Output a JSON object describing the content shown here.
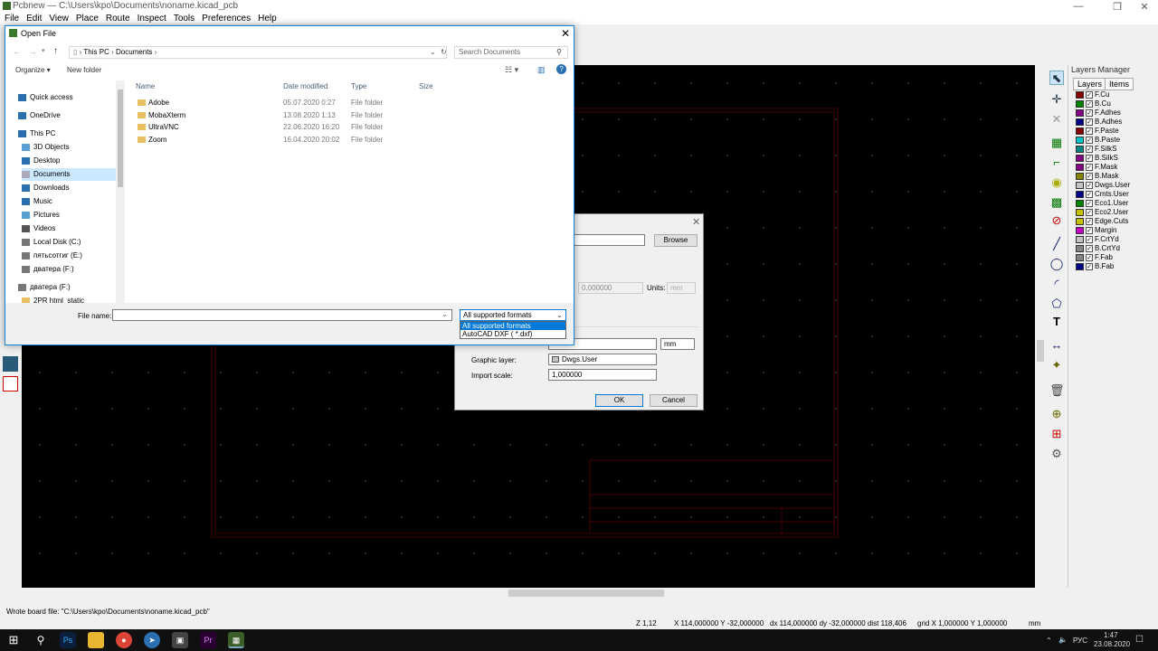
{
  "app": {
    "title": "Pcbnew — C:\\Users\\kpo\\Documents\\noname.kicad_pcb",
    "menu": [
      "File",
      "Edit",
      "View",
      "Place",
      "Route",
      "Inspect",
      "Tools",
      "Preferences",
      "Help"
    ]
  },
  "layers_manager": {
    "title": "Layers Manager",
    "tabs": [
      "Layers",
      "Items"
    ],
    "layers": [
      {
        "name": "F.Cu",
        "color": "#840000"
      },
      {
        "name": "B.Cu",
        "color": "#008400"
      },
      {
        "name": "F.Adhes",
        "color": "#840084"
      },
      {
        "name": "B.Adhes",
        "color": "#000084"
      },
      {
        "name": "F.Paste",
        "color": "#840000"
      },
      {
        "name": "B.Paste",
        "color": "#00c2c2"
      },
      {
        "name": "F.SilkS",
        "color": "#008484"
      },
      {
        "name": "B.SilkS",
        "color": "#840084"
      },
      {
        "name": "F.Mask",
        "color": "#840084"
      },
      {
        "name": "B.Mask",
        "color": "#848400"
      },
      {
        "name": "Dwgs.User",
        "color": "#c2c2c2"
      },
      {
        "name": "Cmts.User",
        "color": "#000084"
      },
      {
        "name": "Eco1.User",
        "color": "#008400"
      },
      {
        "name": "Eco2.User",
        "color": "#c2c200"
      },
      {
        "name": "Edge.Cuts",
        "color": "#c2c200"
      },
      {
        "name": "Margin",
        "color": "#c200c2"
      },
      {
        "name": "F.CrtYd",
        "color": "#c2c2c2"
      },
      {
        "name": "B.CrtYd",
        "color": "#848484"
      },
      {
        "name": "F.Fab",
        "color": "#848484"
      },
      {
        "name": "B.Fab",
        "color": "#000084"
      }
    ]
  },
  "import_dialog": {
    "browse": "Browse",
    "coord_value": "0,000000",
    "units_label": "Units:",
    "units_value": "mm",
    "line_width_units": "mm",
    "graphic_layer_label": "Graphic layer:",
    "graphic_layer_value": "Dwgs.User",
    "import_scale_label": "Import scale:",
    "import_scale_value": "1,000000",
    "ok": "OK",
    "cancel": "Cancel"
  },
  "open_file": {
    "title": "Open File",
    "breadcrumb": [
      "This PC",
      "Documents"
    ],
    "search_placeholder": "Search Documents",
    "organize": "Organize ▾",
    "new_folder": "New folder",
    "nav": [
      {
        "label": "Quick access",
        "icon": "star-icon",
        "indent": 0
      },
      {
        "label": "OneDrive",
        "icon": "cloud-icon",
        "indent": 0
      },
      {
        "label": "This PC",
        "icon": "computer-icon",
        "indent": 0
      },
      {
        "label": "3D Objects",
        "icon": "cube-icon",
        "indent": 1
      },
      {
        "label": "Desktop",
        "icon": "desktop-icon",
        "indent": 1
      },
      {
        "label": "Documents",
        "icon": "document-icon",
        "indent": 1,
        "selected": true
      },
      {
        "label": "Downloads",
        "icon": "download-icon",
        "indent": 1
      },
      {
        "label": "Music",
        "icon": "music-icon",
        "indent": 1
      },
      {
        "label": "Pictures",
        "icon": "picture-icon",
        "indent": 1
      },
      {
        "label": "Videos",
        "icon": "video-icon",
        "indent": 1
      },
      {
        "label": "Local Disk (C:)",
        "icon": "disk-icon",
        "indent": 1
      },
      {
        "label": "пятьсотгиг (E:)",
        "icon": "drive-icon",
        "indent": 1
      },
      {
        "label": "дватера (F:)",
        "icon": "drive-icon",
        "indent": 1
      },
      {
        "label": "дватера (F:)",
        "icon": "drive-icon",
        "indent": 0
      },
      {
        "label": "2PR html_static",
        "icon": "folder-icon",
        "indent": 1
      }
    ],
    "columns": [
      "Name",
      "Date modified",
      "Type",
      "Size"
    ],
    "files": [
      {
        "name": "Adobe",
        "date": "05.07.2020 0:27",
        "type": "File folder",
        "size": ""
      },
      {
        "name": "MobaXterm",
        "date": "13.08.2020 1:13",
        "type": "File folder",
        "size": ""
      },
      {
        "name": "UltraVNC",
        "date": "22.06.2020 16:20",
        "type": "File folder",
        "size": ""
      },
      {
        "name": "Zoom",
        "date": "16.04.2020 20:02",
        "type": "File folder",
        "size": ""
      }
    ],
    "filename_label": "File name:",
    "filename_value": "",
    "filetype_selected": "All supported formats",
    "filetype_options": [
      "All supported formats",
      "AutoCAD DXF ( *.dxf)"
    ]
  },
  "status": {
    "message": "Wrote board file: \"C:\\Users\\kpo\\Documents\\noname.kicad_pcb\"",
    "zoom": "Z 1,12",
    "xy": "X 114,000000  Y -32,000000",
    "delta": "dx 114,000000  dy -32,000000  dist 118,406",
    "grid": "grid X 1,000000  Y 1,000000",
    "units": "mm"
  },
  "taskbar": {
    "lang": "РУС",
    "time": "1:47",
    "date": "23.08.2020"
  }
}
